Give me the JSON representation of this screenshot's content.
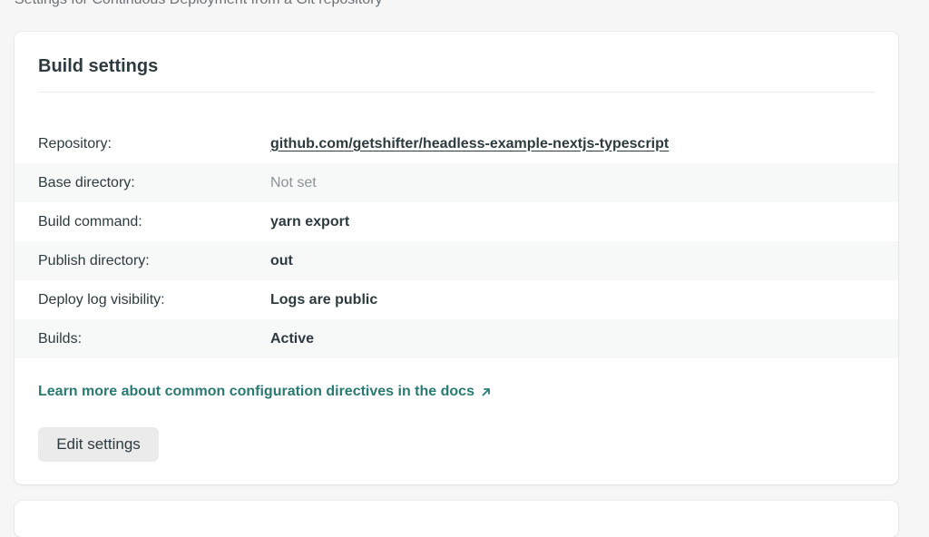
{
  "page": {
    "subtitle": "Settings for Continuous Deployment from a Git repository"
  },
  "build_settings": {
    "title": "Build settings",
    "rows": [
      {
        "label": "Repository:",
        "value": "github.com/getshifter/headless-example-nextjs-typescript"
      },
      {
        "label": "Base directory:",
        "value": "Not set"
      },
      {
        "label": "Build command:",
        "value": "yarn export"
      },
      {
        "label": "Publish directory:",
        "value": "out"
      },
      {
        "label": "Deploy log visibility:",
        "value": "Logs are public"
      },
      {
        "label": "Builds:",
        "value": "Active"
      }
    ],
    "docs_link": "Learn more about common configuration directives in the docs",
    "docs_link_icon": "external-arrow-icon",
    "edit_button": "Edit settings"
  },
  "colors": {
    "accent": "#2a7a74",
    "text": "#2d3b41",
    "muted": "#8a9396",
    "row_alt": "#f7f8f8",
    "button_bg": "#ebebeb"
  }
}
